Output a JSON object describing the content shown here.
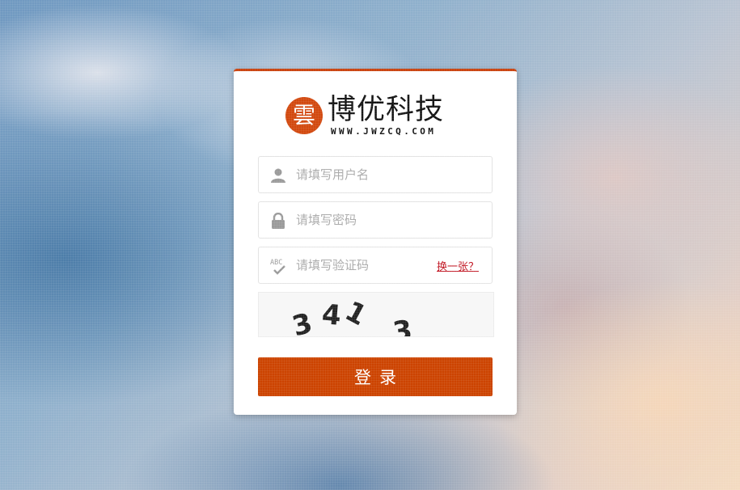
{
  "colors": {
    "accent": "#cc4300",
    "link": "#c0121f",
    "card": "#ffffff"
  },
  "logo": {
    "badge_char": "雲",
    "name": "博优科技",
    "url": "WWW.JWZCQ.COM"
  },
  "form": {
    "username": {
      "placeholder": "请填写用户名",
      "value": "",
      "icon": "user-icon"
    },
    "password": {
      "placeholder": "请填写密码",
      "value": "",
      "icon": "lock-icon"
    },
    "captcha": {
      "placeholder": "请填写验证码",
      "value": "",
      "icon": "abc-check-icon",
      "refresh_label": "换一张？"
    },
    "captcha_image": {
      "chars": [
        "3",
        "4",
        "1",
        "3"
      ]
    },
    "submit_label": "登录"
  }
}
